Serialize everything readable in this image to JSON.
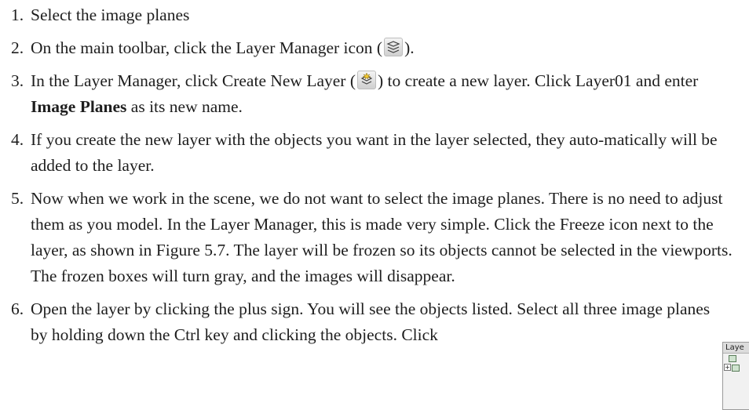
{
  "steps": [
    {
      "number": "1.",
      "text": "Select the image planes"
    },
    {
      "number": "2.",
      "text_before": "On the main toolbar, click the Layer Manager icon (",
      "text_after": ")."
    },
    {
      "number": "3.",
      "text_before": "In the Layer Manager, click Create New Layer (",
      "text_middle": ") to create a new layer. Click Layer01 and enter ",
      "bold": "Image Planes",
      "text_after": " as its new name."
    },
    {
      "number": "4.",
      "text": "If you create the new layer with the objects you want in the layer selected, they auto-matically will be added to the layer."
    },
    {
      "number": "5.",
      "text": "Now when we work in the scene, we do not want to select the image planes. There is no need to adjust them as you model. In the Layer Manager, this is made very simple. Click the Freeze icon next to the layer, as shown in Figure 5.7. The layer will be frozen so its objects cannot be selected in the viewports. The frozen boxes will turn gray, and the images will disappear."
    },
    {
      "number": "6.",
      "text": "Open the layer by clicking the plus sign. You will see the objects listed. Select all three image planes by holding down the Ctrl key and clicking the objects. Click"
    }
  ],
  "icons": {
    "layer_manager": "layer-manager-icon",
    "create_new_layer": "create-new-layer-icon"
  },
  "thumbnail": {
    "title": "Laye"
  }
}
